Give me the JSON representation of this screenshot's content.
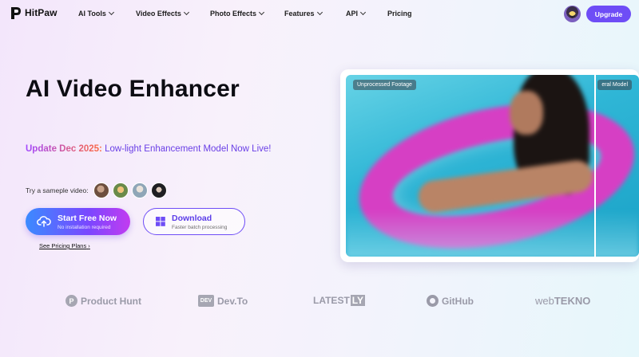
{
  "nav": {
    "logo_text": "HitPaw",
    "items": [
      {
        "label": "AI Tools",
        "has_dropdown": true
      },
      {
        "label": "Video Effects",
        "has_dropdown": true
      },
      {
        "label": "Photo Effects",
        "has_dropdown": true
      },
      {
        "label": "Features",
        "has_dropdown": true
      },
      {
        "label": "API",
        "has_dropdown": true
      },
      {
        "label": "Pricing",
        "has_dropdown": false
      }
    ],
    "upgrade_label": "Upgrade"
  },
  "hero": {
    "title": "AI Video Enhancer",
    "update_date": "Update Dec 2025:",
    "update_text": "Low-light Enhancement Model Now Live!",
    "sample_label": "Try a sameple video:",
    "start_button": {
      "label": "Start Free Now",
      "sublabel": "No installation required"
    },
    "download_button": {
      "label": "Download",
      "sublabel": "Faster batch processing"
    },
    "pricing_link": "See Pricing Plans"
  },
  "video": {
    "left_tag": "Unprocessed Footage",
    "right_tag": "eral Model"
  },
  "logos": [
    {
      "name": "Product Hunt",
      "icon": "P"
    },
    {
      "name": "Dev.To",
      "icon": "DEV"
    },
    {
      "name": "LATEST",
      "suffix": "LY"
    },
    {
      "name": "GitHub"
    },
    {
      "name_light": "web",
      "name_bold": "TEKNO"
    }
  ],
  "colors": {
    "accent": "#6e4df6",
    "update_gradient_start": "#a044ff",
    "update_gradient_end": "#ff6a3d"
  }
}
